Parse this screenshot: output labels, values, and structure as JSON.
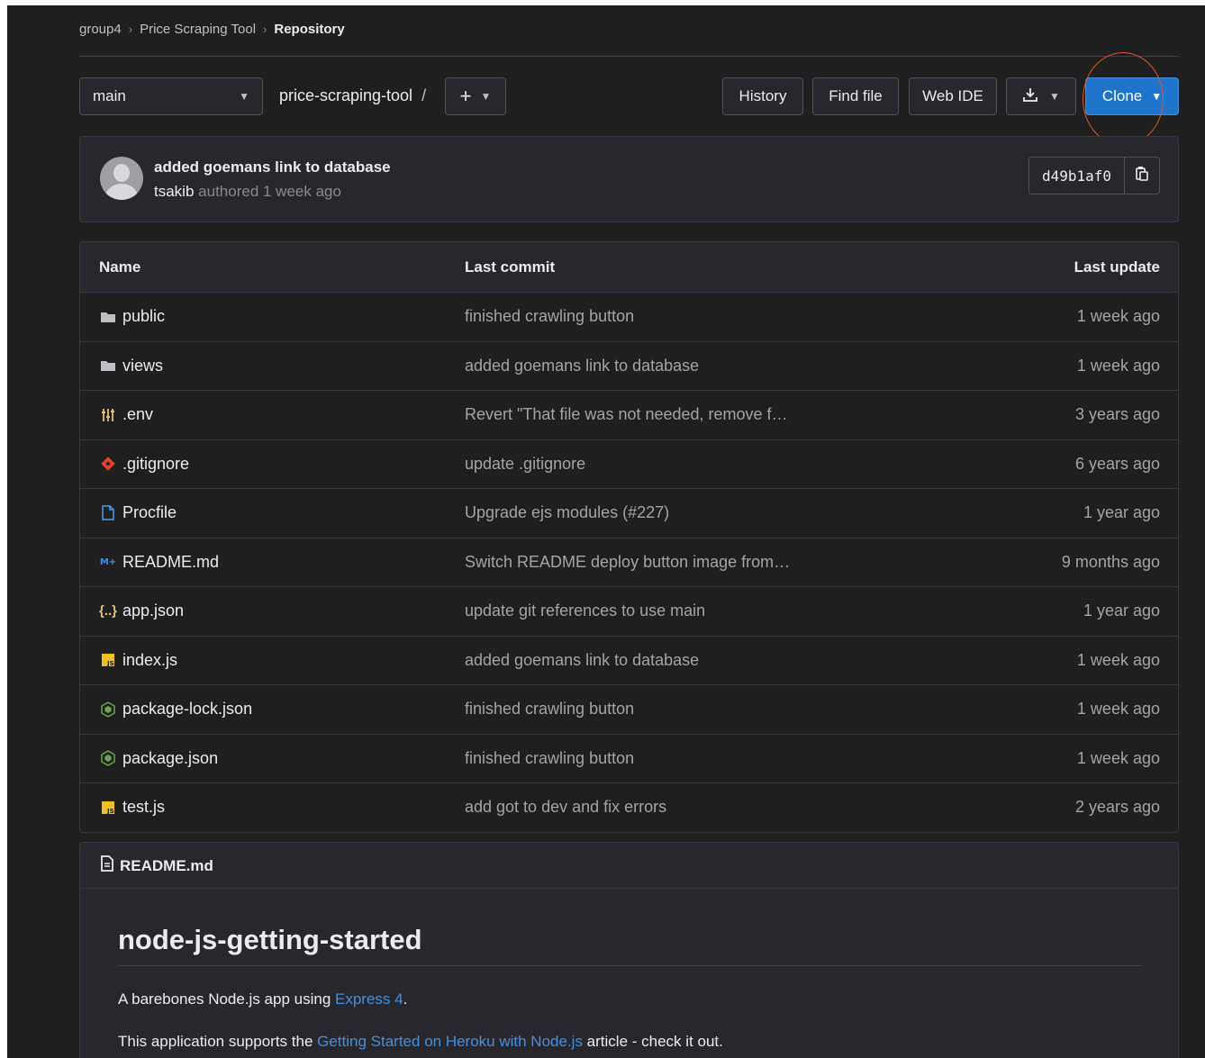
{
  "breadcrumb": {
    "items": [
      "group4",
      "Price Scraping Tool",
      "Repository"
    ],
    "separator": "›"
  },
  "toolbar": {
    "branch": "main",
    "path": "price-scraping-tool",
    "path_sep": "/",
    "plus_label": "+",
    "history_label": "History",
    "find_file_label": "Find file",
    "web_ide_label": "Web IDE",
    "clone_label": "Clone"
  },
  "commit": {
    "title": "added goemans link to database",
    "author": "tsakib",
    "meta": "authored 1 week ago",
    "sha": "d49b1af0"
  },
  "table": {
    "headers": {
      "name": "Name",
      "last_commit": "Last commit",
      "last_update": "Last update"
    },
    "rows": [
      {
        "icon": "folder-icon",
        "name": "public",
        "commit": "finished crawling button",
        "updated": "1 week ago"
      },
      {
        "icon": "folder-icon",
        "name": "views",
        "commit": "added goemans link to database",
        "updated": "1 week ago"
      },
      {
        "icon": "env-file-icon",
        "name": ".env",
        "commit": "Revert \"That file was not needed, remove f…",
        "updated": "3 years ago"
      },
      {
        "icon": "git-file-icon",
        "name": ".gitignore",
        "commit": "update .gitignore",
        "updated": "6 years ago"
      },
      {
        "icon": "file-icon",
        "name": "Procfile",
        "commit": "Upgrade ejs modules (#227)",
        "updated": "1 year ago"
      },
      {
        "icon": "markdown-file-icon",
        "name": "README.md",
        "commit": "Switch README deploy button image from…",
        "updated": "9 months ago"
      },
      {
        "icon": "json-file-icon",
        "name": "app.json",
        "commit": "update git references to use main",
        "updated": "1 year ago"
      },
      {
        "icon": "js-file-icon",
        "name": "index.js",
        "commit": "added goemans link to database",
        "updated": "1 week ago"
      },
      {
        "icon": "node-file-icon",
        "name": "package-lock.json",
        "commit": "finished crawling button",
        "updated": "1 week ago"
      },
      {
        "icon": "node-file-icon",
        "name": "package.json",
        "commit": "finished crawling button",
        "updated": "1 week ago"
      },
      {
        "icon": "js-file-icon",
        "name": "test.js",
        "commit": "add got to dev and fix errors",
        "updated": "2 years ago"
      }
    ]
  },
  "readme": {
    "filename": "README.md",
    "heading": "node-js-getting-started",
    "p1_before": "A barebones Node.js app using ",
    "p1_link": "Express 4",
    "p1_after": ".",
    "p2_before": "This application supports the ",
    "p2_link": "Getting Started on Heroku with Node.js",
    "p2_after": " article - check it out."
  },
  "colors": {
    "background": "#1f1f1f",
    "panel": "#28272d",
    "border": "#3a383f",
    "accent": "#1f75cb",
    "link": "#428fdc",
    "annotation": "#e0562a"
  }
}
